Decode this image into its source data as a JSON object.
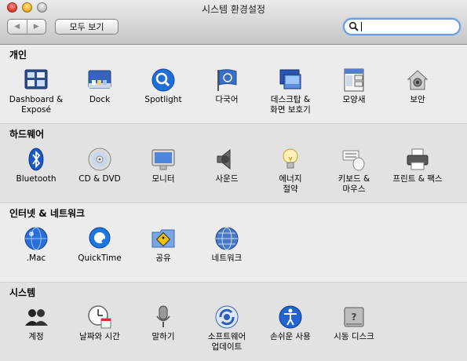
{
  "window": {
    "title": "시스템 환경설정",
    "show_all_label": "모두 보기",
    "back_glyph": "◀",
    "forward_glyph": "▶",
    "search_value": "",
    "search_icon": "magnifier-icon"
  },
  "sections": [
    {
      "title": "개인",
      "items": [
        {
          "label": "Dashboard &\nExposé",
          "icon": "dashboard-expose-icon"
        },
        {
          "label": "Dock",
          "icon": "dock-icon"
        },
        {
          "label": "Spotlight",
          "icon": "spotlight-icon"
        },
        {
          "label": "다국어",
          "icon": "international-flag-icon"
        },
        {
          "label": "데스크탑 &\n화면 보호기",
          "icon": "desktop-screensaver-icon"
        },
        {
          "label": "모양새",
          "icon": "appearance-icon"
        },
        {
          "label": "보안",
          "icon": "security-house-icon"
        }
      ]
    },
    {
      "title": "하드웨어",
      "items": [
        {
          "label": "Bluetooth",
          "icon": "bluetooth-icon"
        },
        {
          "label": "CD & DVD",
          "icon": "cd-dvd-icon"
        },
        {
          "label": "모니터",
          "icon": "monitor-icon"
        },
        {
          "label": "사운드",
          "icon": "speaker-icon"
        },
        {
          "label": "에너지\n절약",
          "icon": "lightbulb-icon"
        },
        {
          "label": "키보드 &\n마우스",
          "icon": "keyboard-mouse-icon"
        },
        {
          "label": "프린트 & 팩스",
          "icon": "printer-icon"
        }
      ]
    },
    {
      "title": "인터넷 & 네트워크",
      "items": [
        {
          "label": ".Mac",
          "icon": "dotmac-globe-icon"
        },
        {
          "label": "QuickTime",
          "icon": "quicktime-icon"
        },
        {
          "label": "공유",
          "icon": "sharing-folder-icon"
        },
        {
          "label": "네트워크",
          "icon": "network-globe-icon"
        }
      ]
    },
    {
      "title": "시스템",
      "items": [
        {
          "label": "계정",
          "icon": "accounts-icon"
        },
        {
          "label": "날짜와 시간",
          "icon": "date-time-icon"
        },
        {
          "label": "말하기",
          "icon": "microphone-icon"
        },
        {
          "label": "소프트웨어\n업데이트",
          "icon": "software-update-icon"
        },
        {
          "label": "손쉬운 사용",
          "icon": "universal-access-icon"
        },
        {
          "label": "시동 디스크",
          "icon": "startup-disk-icon"
        }
      ]
    }
  ]
}
